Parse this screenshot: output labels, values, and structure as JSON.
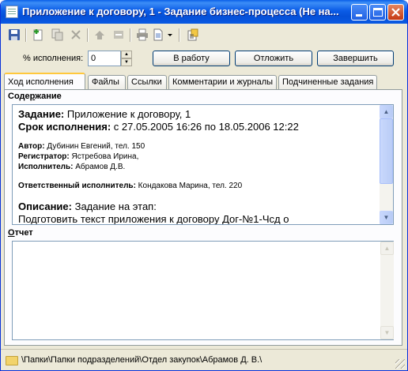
{
  "window": {
    "title": "Приложение к договору, 1 - Задание бизнес-процесса (Не на...",
    "accent": "#0a5ae3"
  },
  "toolbar": {
    "icons": [
      "save-icon",
      "new-icon",
      "copy-icon",
      "delete-icon",
      "forward-icon",
      "return-icon",
      "print-icon",
      "document-icon",
      "dropdown-icon",
      "properties-icon"
    ]
  },
  "progress": {
    "label": "% исполнения:",
    "value": "0",
    "buttons": {
      "to_work": "В работу",
      "postpone": "Отложить",
      "complete": "Завершить"
    }
  },
  "tabs": [
    {
      "label": "Ход исполнения",
      "active": true
    },
    {
      "label": "Файлы",
      "active": false
    },
    {
      "label": "Ссылки",
      "active": false
    },
    {
      "label": "Комментарии и журналы",
      "active": false
    },
    {
      "label": "Подчиненные задания",
      "active": false
    }
  ],
  "content": {
    "section_label_pre": "Соде",
    "section_label_acc": "р",
    "section_label_post": "жание",
    "task_label": "Задание:",
    "task_value": " Приложение к договору, 1",
    "deadline_label": "Срок исполнения:",
    "deadline_value": " с 27.05.2005 16:26 по 18.05.2006 12:22",
    "author_label": "Автор:",
    "author_value": " Дубинин Евгений, тел. 150",
    "registrar_label": "Регистратор:",
    "registrar_value": " Ястребова Ирина,",
    "executor_label": "Исполнитель:",
    "executor_value": " Абрамов Д.В.",
    "responsible_label": "Ответственный исполнитель:",
    "responsible_value": " Кондакова Марина, тел. 220",
    "description_label": "Описание:",
    "description_value": " Задание на этап:",
    "description_line2": "Подготовить текст приложения к договору Дог-№1-Чсд о"
  },
  "report": {
    "section_label_acc": "О",
    "section_label_post": "тчет"
  },
  "status": {
    "path": "\\Папки\\Папки подразделений\\Отдел закупок\\Абрамов Д. В.\\"
  }
}
